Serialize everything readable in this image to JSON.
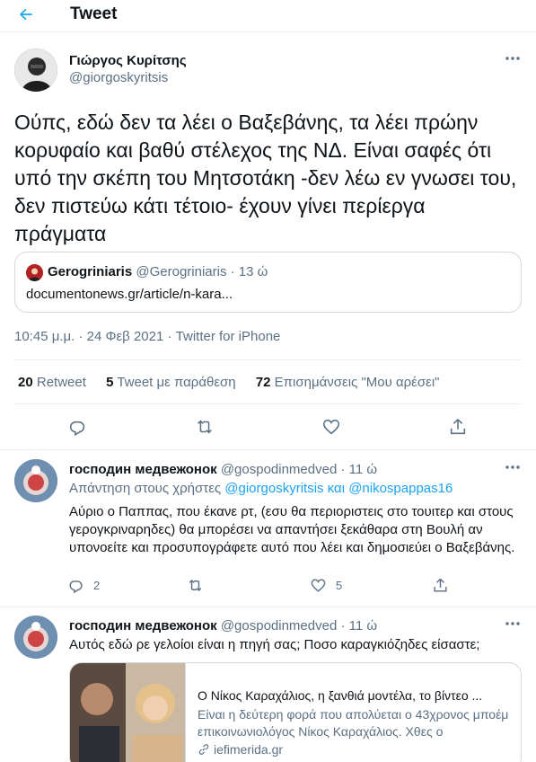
{
  "header": {
    "title": "Tweet"
  },
  "tweet": {
    "author_name": "Γιώργος Κυρίτσης",
    "author_handle": "@giorgoskyritsis",
    "text": "Ούπς, εδώ δεν τα λέει ο Βαξεβάνης, τα λέει πρώην κορυφαίο και βαθύ στέλεχος της ΝΔ. Είναι σαφές ότι υπό την σκέπη του Μητσοτάκη -δεν λέω εν γνωσει του, δεν πιστεύω κάτι τέτοιο- έχουν γίνει περίεργα πράγματα",
    "quote": {
      "name": "Gerogriniaris",
      "handle": "@Gerogriniaris",
      "time": "· 13 ώ",
      "text": "documentonews.gr/article/n-kara..."
    },
    "meta": "10:45 μ.μ. · 24 Φεβ 2021 · Twitter for iPhone",
    "stats": {
      "retweets_count": "20",
      "retweets_label": "Retweet",
      "quotes_count": "5",
      "quotes_label": "Tweet με παράθεση",
      "likes_count": "72",
      "likes_label": "Επισημάνσεις \"Μου αρέσει\""
    }
  },
  "replies": [
    {
      "name": "господин медвежонок",
      "handle": "@gospodinmedved",
      "time": "· 11 ώ",
      "reply_prefix": "Απάντηση στους χρήστες",
      "reply_to": "@giorgoskyritsis και @nikospappas16",
      "text": "Αύριο ο Παππας, που έκανε ρτ, (εσυ θα περιοριστεις στο τουιτερ και στους γερογκριναρηδες) θα μπορέσει να απαντήσει ξεκάθαρα στη Βουλή αν υπονοείτε και προσυπογράφετε αυτό που λέει και δημοσιεύει ο Βαξεβάνης.",
      "reply_count": "2",
      "like_count": "5"
    },
    {
      "name": "господин медвежонок",
      "handle": "@gospodinmedved",
      "time": "· 11 ώ",
      "text": "Αυτός εδώ ρε γελοίοι είναι η πηγή σας; Ποσο καραγκιόζηδες είσαστε;",
      "card": {
        "title": "Ο Νίκος Καραχάλιος, η ξανθιά μοντέλα, το βίντεο ...",
        "desc": "Είναι η δεύτερη φορά που απολύεται ο 43χρονος μποέμ επικοινωνιολόγος Νίκος Καραχάλιος. Χθες ο",
        "domain": "iefimerida.gr"
      }
    }
  ],
  "colors": {
    "accent": "#1da1f2",
    "secondary_text": "#5b7083",
    "border": "#ebeef0"
  }
}
